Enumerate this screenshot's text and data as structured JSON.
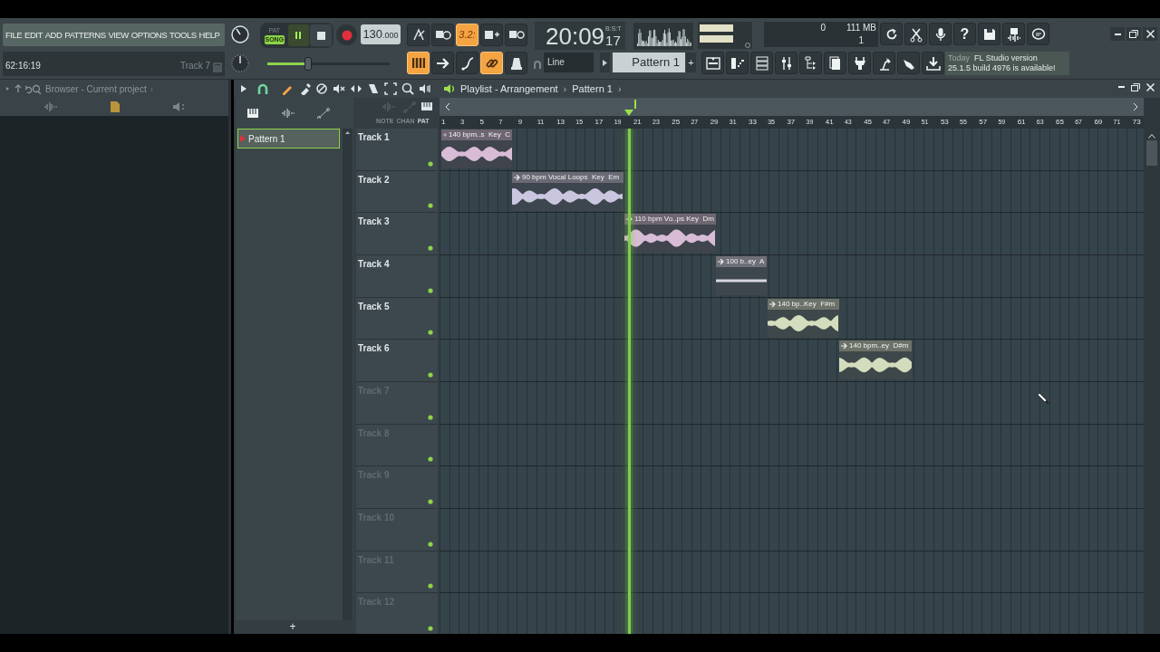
{
  "menu": [
    "FILE",
    "EDIT",
    "ADD",
    "PATTERNS",
    "VIEW",
    "OPTIONS",
    "TOOLS",
    "HELP"
  ],
  "hint_bar": {
    "time": "62:16:19",
    "track": "Track 7"
  },
  "transport": {
    "modes": [
      {
        "label": "PAT",
        "selected": false
      },
      {
        "label": "SONG",
        "selected": true
      }
    ],
    "playing": true,
    "tempo": "130",
    "tempo_fraction": ".000",
    "master_volume": {
      "level": 0.33
    }
  },
  "toggles_top": [
    {
      "on": false
    },
    {
      "on": false
    },
    {
      "on": true,
      "label": "3.2:"
    },
    {
      "on": false
    },
    {
      "on": false
    }
  ],
  "toggles_bottom": [
    {
      "on": true
    },
    {
      "on": false
    },
    {
      "on": false
    },
    {
      "on": true
    },
    {
      "on": false
    }
  ],
  "clock": {
    "time": "20:09",
    "ticks": "17",
    "unit": "B:S:T"
  },
  "monitor": {
    "cpu": "0",
    "memory": "111 MB",
    "polyphony": "1"
  },
  "help_label": "?",
  "snap": {
    "value": "Line"
  },
  "pattern_selector": {
    "value": "Pattern 1",
    "add": "+"
  },
  "news": {
    "date": "Today",
    "line_1": "FL Studio version",
    "line_2": "25.1.5 build 4976 is available!"
  },
  "browser": {
    "title": "Browser - Current project",
    "chevron": "›"
  },
  "playlist": {
    "title": "Playlist - Arrangement",
    "separator": "›",
    "pattern": "Pattern 1",
    "chevron": "›",
    "patterns": [
      {
        "label": "Pattern 1",
        "selected": true
      }
    ],
    "add_pattern": "+",
    "column_labels": [
      "NOTE",
      "CHAN",
      "PAT"
    ],
    "ruler": [
      "1",
      "3",
      "5",
      "7",
      "9",
      "11",
      "13",
      "15",
      "17",
      "19",
      "21",
      "23",
      "25",
      "27",
      "29",
      "31",
      "33",
      "35",
      "37",
      "39",
      "41",
      "43",
      "45",
      "47",
      "49",
      "51",
      "53",
      "55",
      "57",
      "59",
      "61",
      "63",
      "65",
      "67",
      "69",
      "71",
      "73"
    ],
    "tracks": [
      {
        "name": "Track 1",
        "dimmed": false,
        "clips": [
          {
            "label": "140 bpm..s  Key  C",
            "color": "#d8bcd6"
          }
        ]
      },
      {
        "name": "Track 2",
        "dimmed": false,
        "clips": [
          {
            "label": "90 bpm Vocal Loops  Key  Em",
            "color": "#cbc6e0"
          }
        ]
      },
      {
        "name": "Track 3",
        "dimmed": false,
        "clips": [
          {
            "label": "110 bpm Vo..ps Key  Dm",
            "color": "#d8bcd6"
          }
        ]
      },
      {
        "name": "Track 4",
        "dimmed": false,
        "clips": [
          {
            "label": "100 b..ey  A",
            "color": "#d9d6e2"
          }
        ]
      },
      {
        "name": "Track 5",
        "dimmed": false,
        "clips": [
          {
            "label": "140 bp..Key  F#m",
            "color": "#d3dcbc"
          }
        ]
      },
      {
        "name": "Track 6",
        "dimmed": false,
        "clips": [
          {
            "label": "140 bpm..ey  D#m",
            "color": "#d3dcbc"
          }
        ]
      },
      {
        "name": "Track 7",
        "dimmed": true
      },
      {
        "name": "Track 8",
        "dimmed": true
      },
      {
        "name": "Track 9",
        "dimmed": true
      },
      {
        "name": "Track 10",
        "dimmed": true
      },
      {
        "name": "Track 11",
        "dimmed": true
      },
      {
        "name": "Track 12",
        "dimmed": true
      }
    ]
  }
}
